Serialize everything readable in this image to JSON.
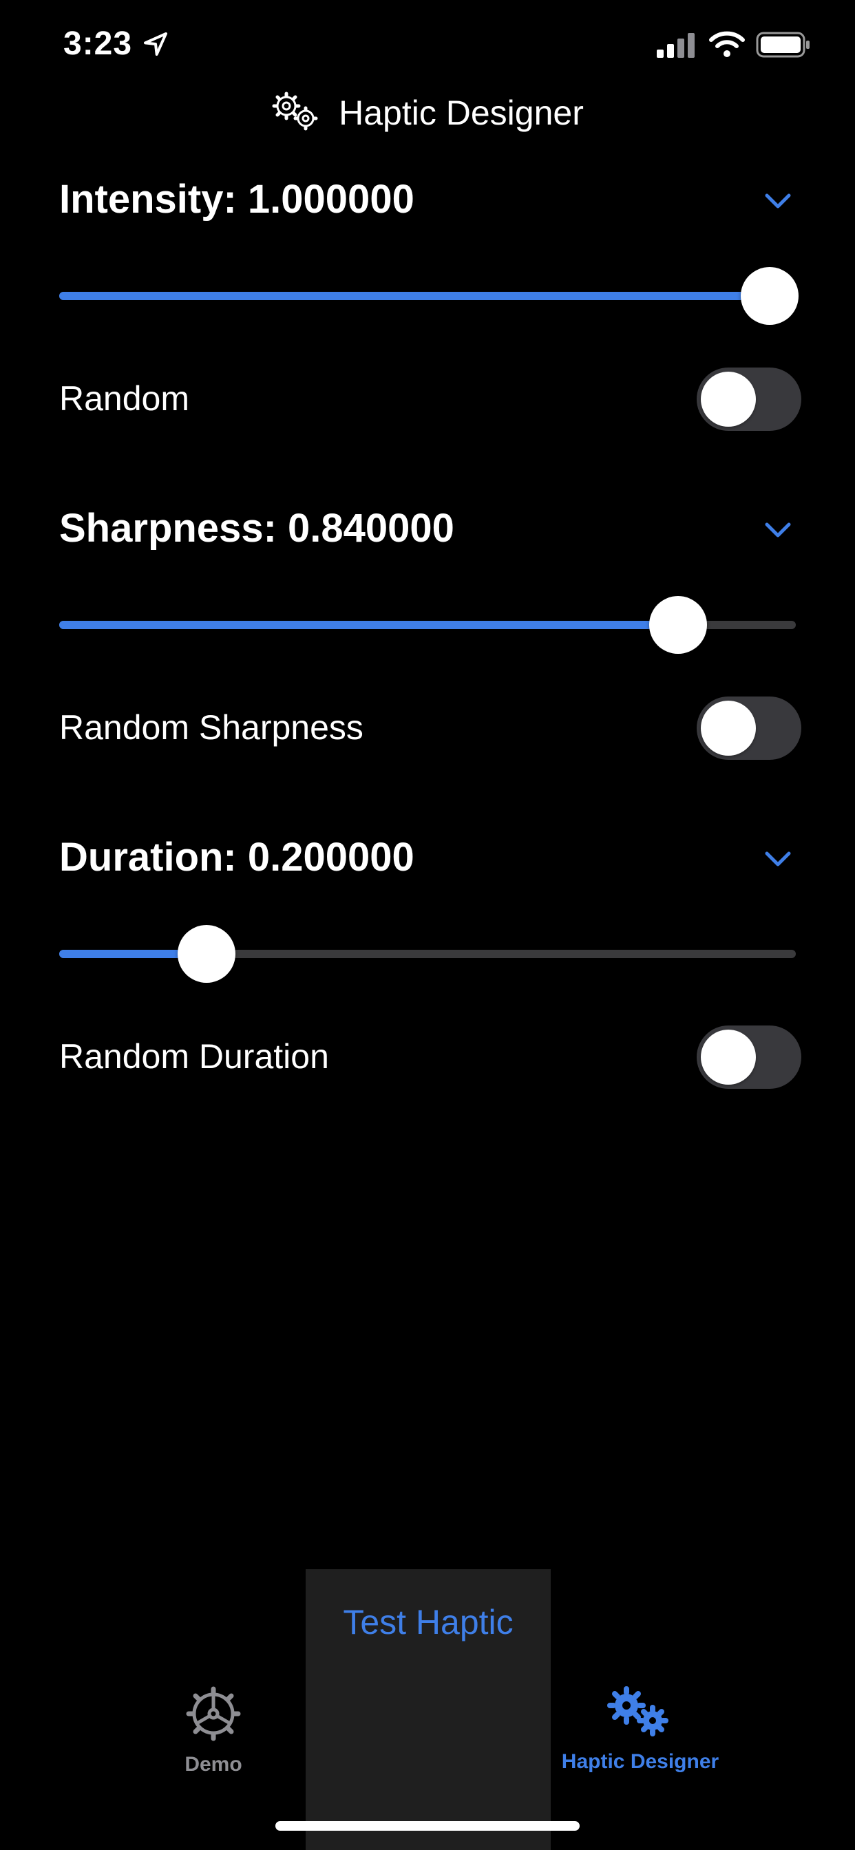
{
  "status_bar": {
    "time": "3:23",
    "icons": [
      "location-arrow-icon",
      "cellular-signal-icon",
      "wifi-icon",
      "battery-icon"
    ]
  },
  "header": {
    "title": "Haptic Designer",
    "icon": "gears-icon"
  },
  "sections": {
    "intensity": {
      "title": "Intensity: 1.000000",
      "value": 1.0,
      "toggle_label": "Random",
      "toggle_on": false
    },
    "sharpness": {
      "title": "Sharpness: 0.840000",
      "value": 0.84,
      "toggle_label": "Random Sharpness",
      "toggle_on": false
    },
    "duration": {
      "title": "Duration: 0.200000",
      "value": 0.2,
      "toggle_label": "Random Duration",
      "toggle_on": false
    }
  },
  "action": {
    "test_label": "Test Haptic"
  },
  "tab_bar": {
    "demo_label": "Demo",
    "demo_icon": "helm-wheel-icon",
    "designer_label": "Haptic Designer",
    "designer_icon": "gears-icon",
    "selected": "Haptic Designer"
  },
  "colors": {
    "accent": "#3f7fe8",
    "background": "#000000",
    "track": "#3a3a3c",
    "toggle_off": "#39393d"
  }
}
